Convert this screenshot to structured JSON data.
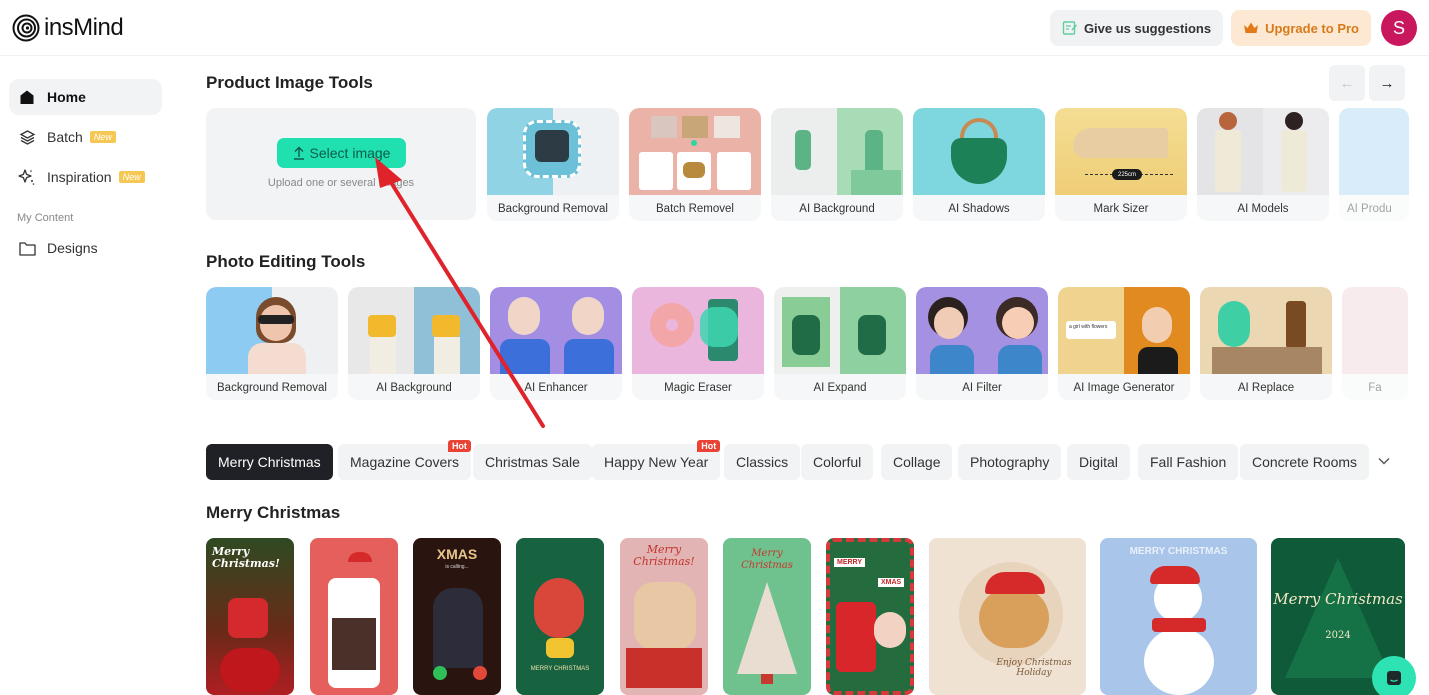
{
  "brand": {
    "name": "insMind"
  },
  "header": {
    "suggest_label": "Give us suggestions",
    "upgrade_label": "Upgrade to Pro",
    "avatar_initial": "S",
    "colors": {
      "avatar": "#c8175c",
      "upgrade_text": "#d67a1a",
      "upgrade_bg": "#fde9d3"
    }
  },
  "sidebar": {
    "items": [
      {
        "label": "Home",
        "icon": "home-icon",
        "active": true
      },
      {
        "label": "Batch",
        "icon": "layers-icon",
        "badge": "New"
      },
      {
        "label": "Inspiration",
        "icon": "sparkle-icon",
        "badge": "New"
      }
    ],
    "section_label": "My Content",
    "content_items": [
      {
        "label": "Designs",
        "icon": "folder-icon"
      }
    ]
  },
  "product_tools": {
    "title": "Product Image Tools",
    "upload": {
      "button_label": "Select image",
      "hint": "Upload one or several images"
    },
    "cards": [
      {
        "label": "Background Removal"
      },
      {
        "label": "Batch Removel"
      },
      {
        "label": "AI Background"
      },
      {
        "label": "AI Shadows"
      },
      {
        "label": "Mark Sizer",
        "measure": "225cm"
      },
      {
        "label": "AI Models"
      },
      {
        "label": "AI Produ"
      }
    ]
  },
  "photo_tools": {
    "title": "Photo Editing Tools",
    "cards": [
      {
        "label": "Background Removal"
      },
      {
        "label": "AI Background"
      },
      {
        "label": "AI Enhancer"
      },
      {
        "label": "Magic Eraser"
      },
      {
        "label": "AI Expand"
      },
      {
        "label": "AI Filter"
      },
      {
        "label": "AI Image Generator",
        "prompt": "a girl with flowers"
      },
      {
        "label": "AI Replace"
      },
      {
        "label": "Fa"
      }
    ]
  },
  "categories": {
    "chips": [
      {
        "label": "Merry Christmas",
        "active": true
      },
      {
        "label": "Magazine Covers",
        "badge": "Hot"
      },
      {
        "label": "Christmas Sale"
      },
      {
        "label": "Happy New Year",
        "badge": "Hot"
      },
      {
        "label": "Classics"
      },
      {
        "label": "Colorful"
      },
      {
        "label": "Collage"
      },
      {
        "label": "Photography"
      },
      {
        "label": "Digital"
      },
      {
        "label": "Fall Fashion"
      },
      {
        "label": "Concrete Rooms"
      }
    ]
  },
  "templates": {
    "title": "Merry Christmas",
    "items": [
      {
        "text": "Merry Christmas!"
      },
      {
        "text": ""
      },
      {
        "text": "XMAS",
        "sub": "is calling..."
      },
      {
        "text": "MERRY CHRISTMAS"
      },
      {
        "text": "Merry Christmas!"
      },
      {
        "text": "Merry Christmas"
      },
      {
        "text": "MERRY",
        "sub": "XMAS"
      },
      {
        "text": "Enjoy Christmas Holiday"
      },
      {
        "text": "MERRY CHRISTMAS"
      },
      {
        "text": "Merry Christmas",
        "sub": "2024"
      }
    ]
  }
}
